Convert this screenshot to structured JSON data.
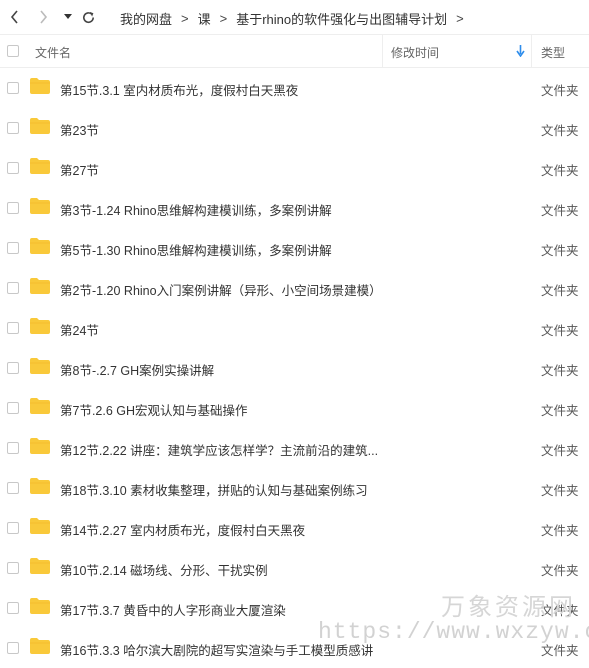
{
  "breadcrumb": {
    "root": "我的网盘",
    "level1": "课",
    "level2": "基于rhino的软件强化与出图辅导计划",
    "separator": ">"
  },
  "columns": {
    "name": "文件名",
    "modified": "修改时间",
    "type": "类型"
  },
  "files": [
    {
      "name": "第15节.3.1 室内材质布光，度假村白天黑夜",
      "type": "文件夹"
    },
    {
      "name": "第23节",
      "type": "文件夹"
    },
    {
      "name": "第27节",
      "type": "文件夹"
    },
    {
      "name": "第3节-1.24 Rhino思维解构建模训练，多案例讲解",
      "type": "文件夹"
    },
    {
      "name": "第5节-1.30 Rhino思维解构建模训练，多案例讲解",
      "type": "文件夹"
    },
    {
      "name": "第2节-1.20 Rhino入门案例讲解（异形、小空间场景建模）",
      "type": "文件夹"
    },
    {
      "name": "第24节",
      "type": "文件夹"
    },
    {
      "name": "第8节-.2.7 GH案例实操讲解",
      "type": "文件夹"
    },
    {
      "name": "第7节.2.6 GH宏观认知与基础操作",
      "type": "文件夹"
    },
    {
      "name": "第12节.2.22 讲座：建筑学应该怎样学？主流前沿的建筑...",
      "type": "文件夹"
    },
    {
      "name": "第18节.3.10 素材收集整理，拼贴的认知与基础案例练习",
      "type": "文件夹"
    },
    {
      "name": "第14节.2.27 室内材质布光，度假村白天黑夜",
      "type": "文件夹"
    },
    {
      "name": "第10节.2.14 磁场线、分形、干扰实例",
      "type": "文件夹"
    },
    {
      "name": "第17节.3.7 黄昏中的人字形商业大厦渲染",
      "type": "文件夹"
    },
    {
      "name": "第16节.3.3 哈尔滨大剧院的超写实渲染与手工模型质感讲",
      "type": "文件夹"
    }
  ],
  "watermark": {
    "brand": "万象资源网",
    "url": "https://www.wxzyw.cn"
  },
  "colors": {
    "folder": "#F9C93A",
    "sort_arrow": "#2E8DEB"
  }
}
